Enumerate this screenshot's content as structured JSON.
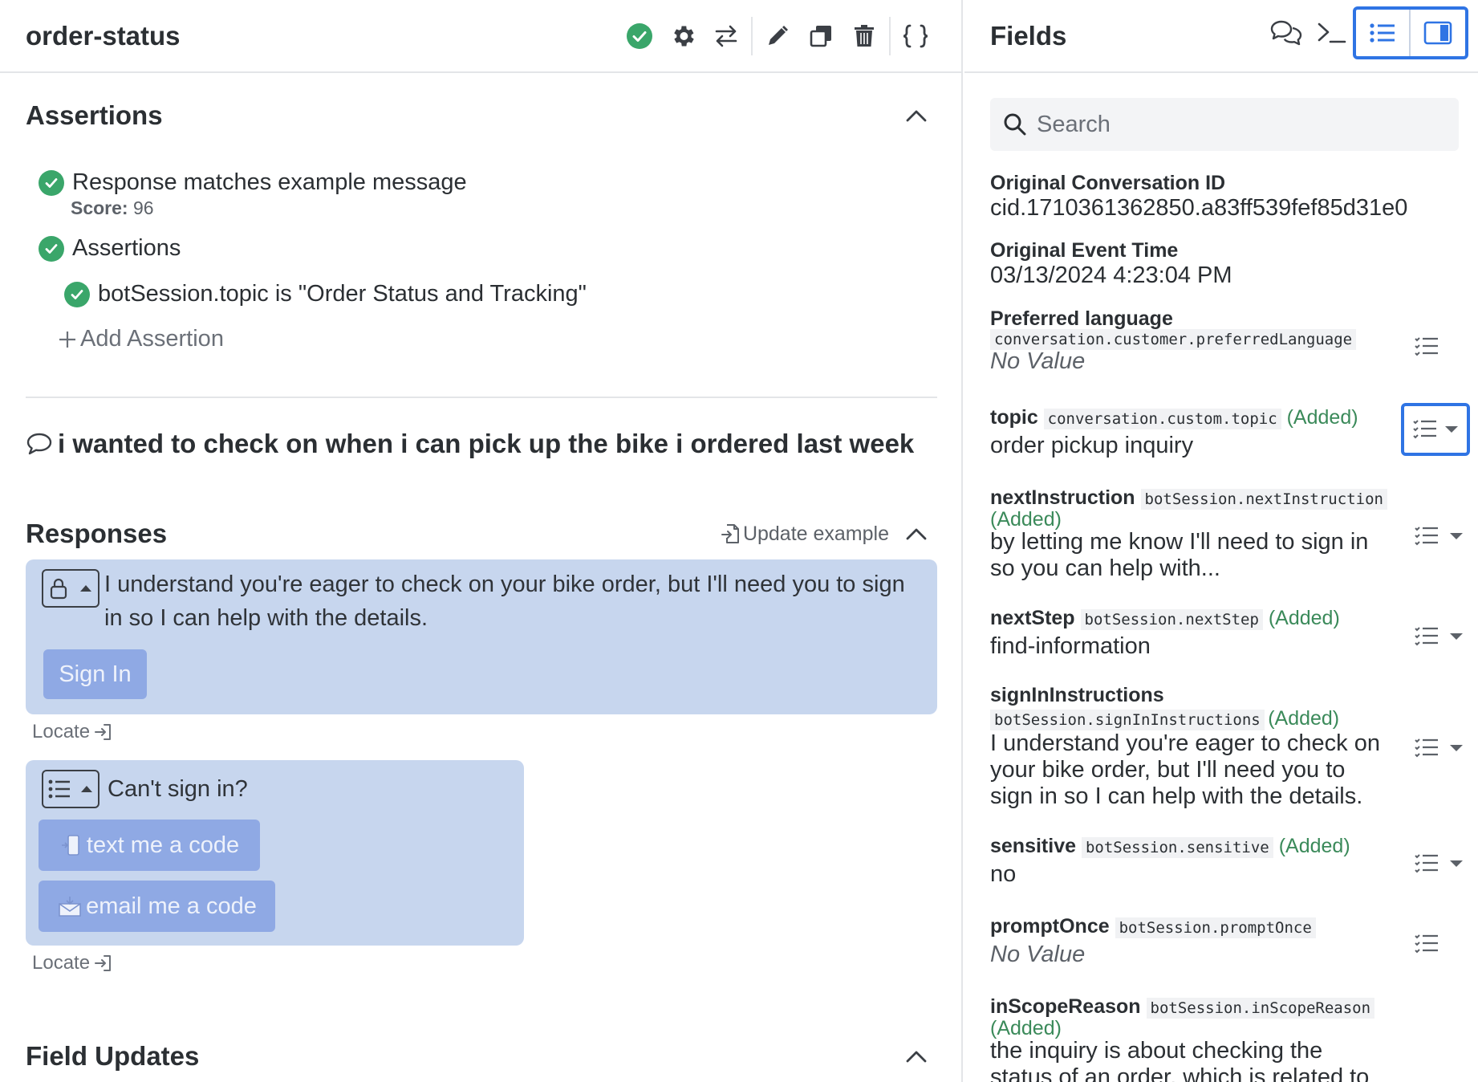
{
  "header": {
    "title": "order-status"
  },
  "assertions": {
    "title": "Assertions",
    "items": [
      {
        "label": "Response matches example message",
        "score_label": "Score:",
        "score_value": "96"
      },
      {
        "label": "Assertions"
      },
      {
        "label": "botSession.topic is \"Order Status and Tracking\""
      }
    ],
    "add_label": "Add Assertion"
  },
  "user_message": "i wanted to check on when i can pick up the bike i ordered last week",
  "responses": {
    "title": "Responses",
    "update_example_label": "Update example",
    "cards": [
      {
        "text": "I understand you're eager to check on your bike order, but I'll need you to sign in so I can help with the details.",
        "button_label": "Sign In",
        "locate_label": "Locate"
      },
      {
        "text": "Can't sign in?",
        "buttons": [
          "text me a code",
          "email me a code"
        ],
        "locate_label": "Locate"
      }
    ]
  },
  "field_updates": {
    "title": "Field Updates"
  },
  "fields_panel": {
    "title": "Fields",
    "search_placeholder": "Search",
    "items": [
      {
        "label": "Original Conversation ID",
        "value": "cid.1710361362850.a83ff539fef85d31e0"
      },
      {
        "label": "Original Event Time",
        "value": "03/13/2024 4:23:04 PM"
      },
      {
        "label": "Preferred language",
        "path": "conversation.customer.preferredLanguage",
        "value": "No Value"
      },
      {
        "label": "topic",
        "path": "conversation.custom.topic",
        "status": "(Added)",
        "value": "order pickup inquiry"
      },
      {
        "label": "nextInstruction",
        "path": "botSession.nextInstruction",
        "status": "(Added)",
        "value_line1": "by letting me know I'll need to sign in",
        "value_line2": "so you can help with..."
      },
      {
        "label": "nextStep",
        "path": "botSession.nextStep",
        "status": "(Added)",
        "value": "find-information"
      },
      {
        "label": "signInInstructions",
        "path": "botSession.signInInstructions",
        "status": "(Added)",
        "value_line1": "I understand you're eager to check on",
        "value_line2": "your bike order, but I'll need you to",
        "value_line3": "sign in so I can help with the details."
      },
      {
        "label": "sensitive",
        "path": "botSession.sensitive",
        "status": "(Added)",
        "value": "no"
      },
      {
        "label": "promptOnce",
        "path": "botSession.promptOnce",
        "value": "No Value"
      },
      {
        "label": "inScopeReason",
        "path": "botSession.inScopeReason",
        "status": "(Added)",
        "value_line1": "the inquiry is about checking the",
        "value_line2": "status of an order, which is related to"
      }
    ]
  },
  "colors": {
    "accent": "#2f74e4",
    "success": "#3aa66a",
    "response_bg": "#c7d6ee",
    "button_bg": "#8fa9e4",
    "added_text": "#3b8a5a"
  }
}
